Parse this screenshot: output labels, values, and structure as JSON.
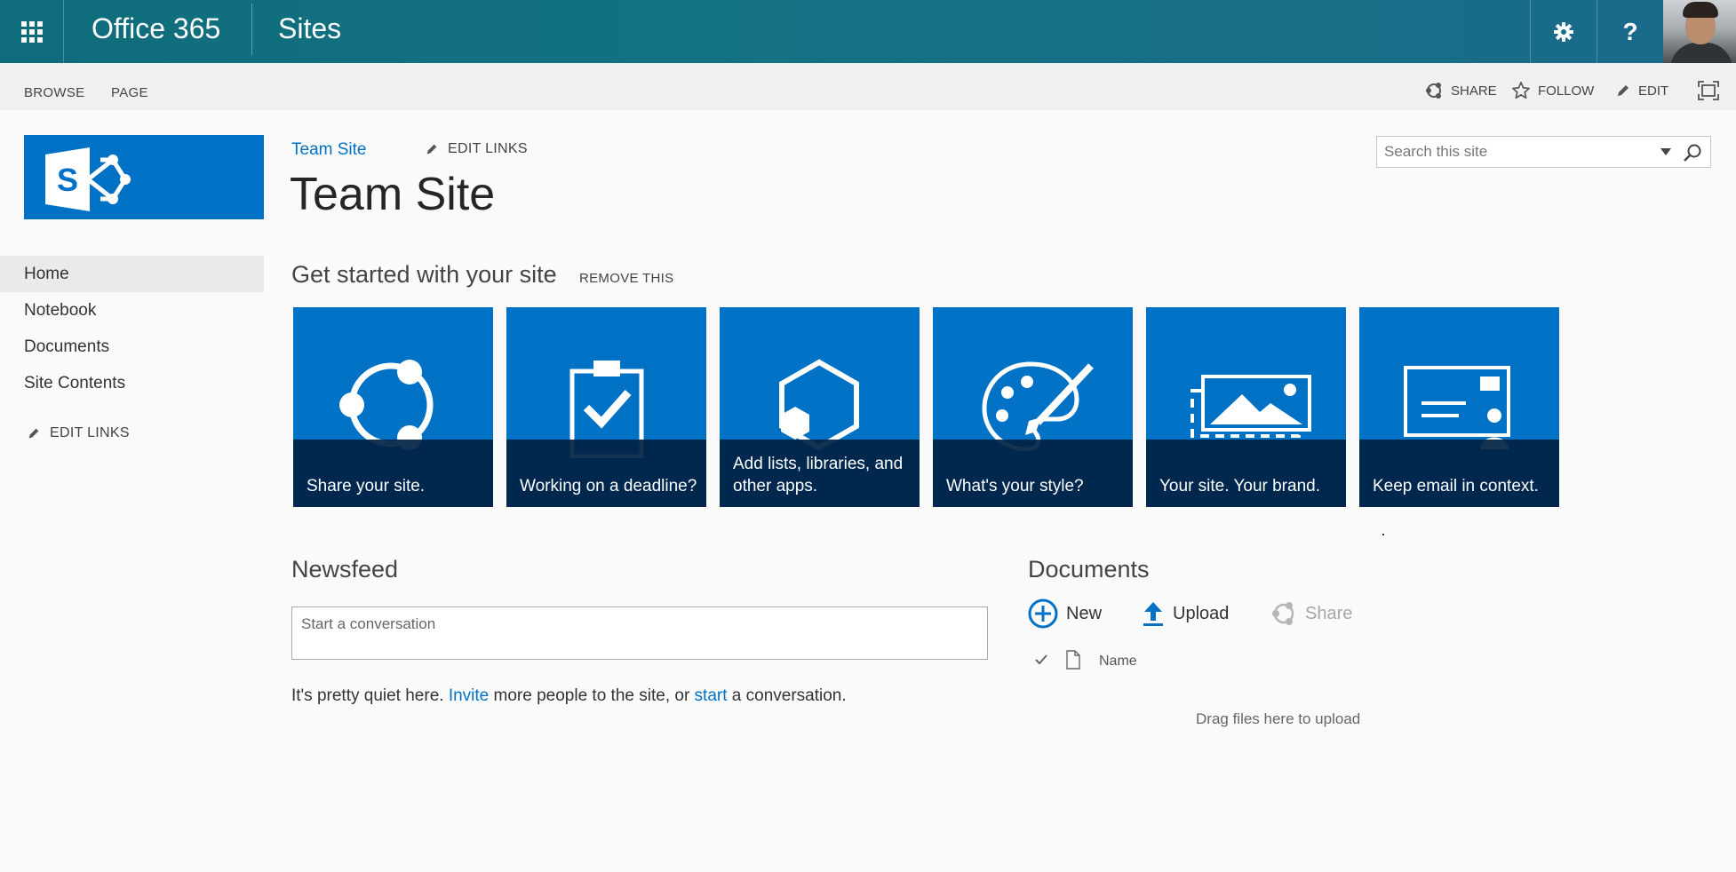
{
  "suite_bar": {
    "brand": "Office 365",
    "app_name": "Sites",
    "help_label": "?"
  },
  "ribbon": {
    "tabs": [
      "BROWSE",
      "PAGE"
    ],
    "share_label": "SHARE",
    "follow_label": "FOLLOW",
    "edit_label": "EDIT"
  },
  "left_nav": {
    "items": [
      "Home",
      "Notebook",
      "Documents",
      "Site Contents"
    ],
    "selected": "Home",
    "edit_links_label": "EDIT LINKS"
  },
  "header": {
    "breadcrumb": "Team Site",
    "edit_links_label": "EDIT LINKS",
    "page_title": "Team Site",
    "search_placeholder": "Search this site"
  },
  "get_started": {
    "title": "Get started with your site",
    "remove_label": "REMOVE THIS",
    "tiles": [
      {
        "label": "Share your site.",
        "icon": "share-icon"
      },
      {
        "label": "Working on a deadline?",
        "icon": "clipboard-check-icon"
      },
      {
        "label": "Add lists, libraries, and other apps.",
        "icon": "apps-hexagon-icon"
      },
      {
        "label": "What's your style?",
        "icon": "palette-icon"
      },
      {
        "label": "Your site. Your brand.",
        "icon": "image-brand-icon"
      },
      {
        "label": "Keep email in context.",
        "icon": "email-context-icon"
      }
    ]
  },
  "newsfeed": {
    "title": "Newsfeed",
    "input_placeholder": "Start a conversation",
    "message_prefix": "It's pretty quiet here. ",
    "invite_link": "Invite",
    "message_middle": " more people to the site, or ",
    "start_link": "start",
    "message_suffix": " a conversation."
  },
  "documents": {
    "title": "Documents",
    "new_label": "New",
    "upload_label": "Upload",
    "share_label": "Share",
    "column_name": "Name",
    "drag_hint": "Drag files here to upload"
  },
  "colors": {
    "suite_bar": "#137282",
    "accent": "#0072c6",
    "tile_bar": "#002142",
    "disabled": "#a6a6a6"
  }
}
